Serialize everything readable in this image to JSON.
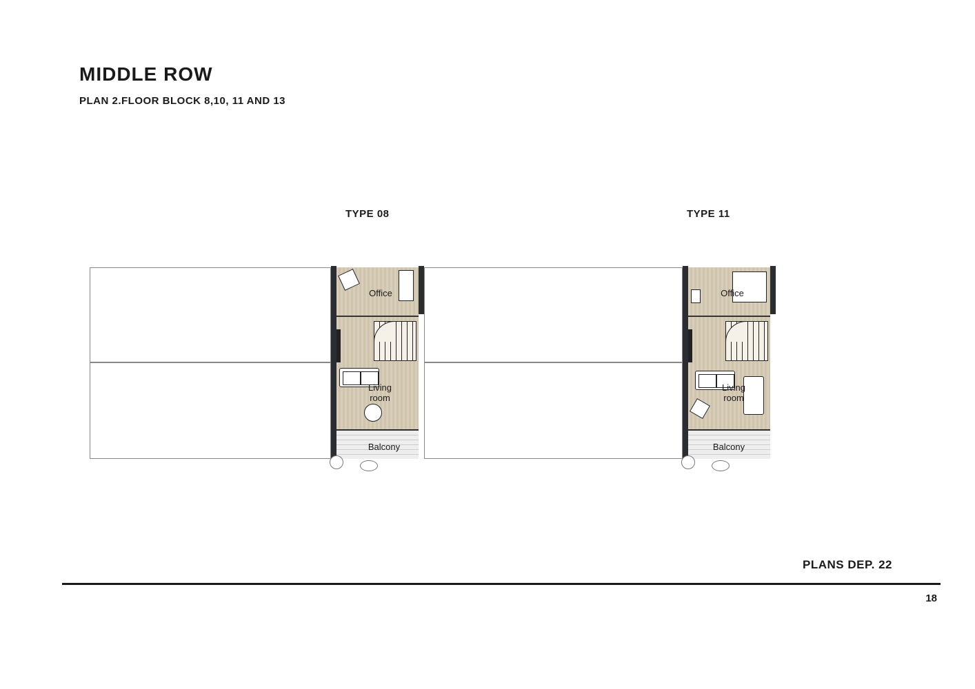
{
  "header": {
    "title": "MIDDLE ROW",
    "subtitle": "PLAN 2.FLOOR BLOCK 8,10, 11 AND 13"
  },
  "units": {
    "type08": {
      "label": "TYPE 08",
      "rooms": {
        "office": "Office",
        "living": "Living room",
        "balcony": "Balcony"
      }
    },
    "type11": {
      "label": "TYPE 11",
      "rooms": {
        "office": "Office",
        "living": "Living room",
        "balcony": "Balcony"
      }
    }
  },
  "footer": {
    "section": "PLANS DEP. 22",
    "page": "18"
  }
}
